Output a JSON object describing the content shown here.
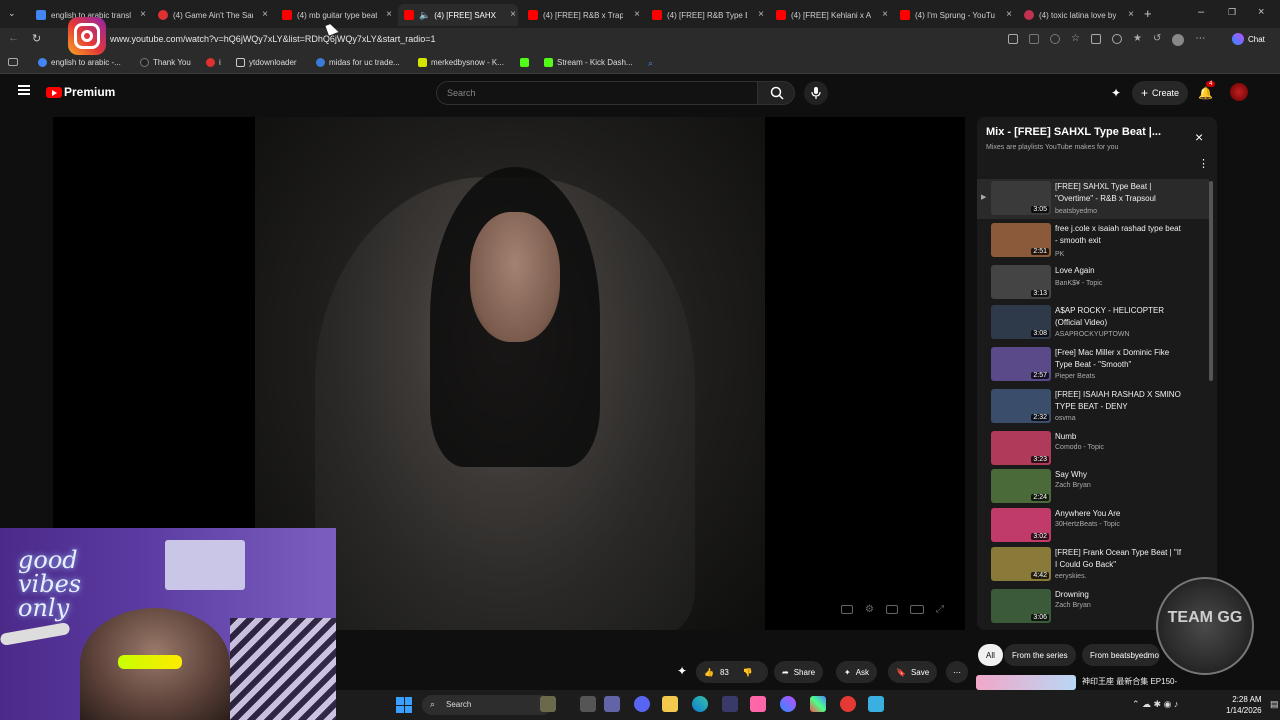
{
  "tabs": [
    {
      "label": "english to arabic translate"
    },
    {
      "label": "(4) Game Ain't The Same"
    },
    {
      "label": "(4) mb guitar type beat"
    },
    {
      "label": "(4) [FREE] SAHXL Type Beat"
    },
    {
      "label": "(4) [FREE] R&B x Trapsoul"
    },
    {
      "label": "(4) [FREE] R&B Type Beat"
    },
    {
      "label": "(4) [FREE] Kehlani x Aaliyah"
    },
    {
      "label": "(4) I'm Sprung - YouTube"
    },
    {
      "label": "(4) toxic latina love by"
    }
  ],
  "address": {
    "url": "www.youtube.com/watch?v=hQ6jWQy7xLY&list=RDhQ6jWQy7xLY&start_radio=1"
  },
  "chat_label": "Chat",
  "bookmarks": [
    {
      "label": "english to arabic -..."
    },
    {
      "label": "Thank You"
    },
    {
      "label": "i"
    },
    {
      "label": "ytdownloader"
    },
    {
      "label": "midas for uc trade..."
    },
    {
      "label": "merkedbysnow - K..."
    },
    {
      "label": "Stream - Kick Dash..."
    }
  ],
  "header": {
    "logo_text": "Premium",
    "search_placeholder": "Search",
    "create_label": "Create",
    "notif_count": "4"
  },
  "playlist": {
    "title": "Mix - [FREE] SAHXL Type Beat |...",
    "subtitle": "Mixes are playlists YouTube makes for you",
    "items": [
      {
        "title": "[FREE] SAHXL Type Beat | \"Overtime\" - R&B x Trapsoul",
        "channel": "beatsbyedmo",
        "duration": "3:05",
        "color": "#3a3a3a"
      },
      {
        "title": "free j.cole x isaiah rashad type beat - smooth exit",
        "channel": "PK",
        "duration": "2:51",
        "color": "#8a5a3a"
      },
      {
        "title": "Love Again",
        "channel": "BanK$¥ - Topic",
        "duration": "3:13",
        "color": "#444"
      },
      {
        "title": "A$AP ROCKY - HELICOPTER (Official Video)",
        "channel": "ASAPROCKYUPTOWN",
        "duration": "3:08",
        "color": "#2e3a4a"
      },
      {
        "title": "[Free] Mac Miller x Dominic Fike Type Beat - \"Smooth\"",
        "channel": "Pieper Beats",
        "duration": "2:57",
        "color": "#5b4a8a"
      },
      {
        "title": "[FREE] ISAIAH RASHAD X SMINO TYPE BEAT - DENY",
        "channel": "osvma",
        "duration": "2:32",
        "color": "#3a4d6a"
      },
      {
        "title": "Numb",
        "channel": "Comodo - Topic",
        "duration": "3:23",
        "color": "#b03a5a"
      },
      {
        "title": "Say Why",
        "channel": "Zach Bryan",
        "duration": "2:24",
        "color": "#4a6a3a"
      },
      {
        "title": "Anywhere You Are",
        "channel": "30HertzBeats - Topic",
        "duration": "3:02",
        "color": "#c03a6a"
      },
      {
        "title": "[FREE] Frank Ocean Type Beat | \"If I Could Go Back\"",
        "channel": "eeryskies.",
        "duration": "4:42",
        "color": "#8a7a3a"
      },
      {
        "title": "Drowning",
        "channel": "Zach Bryan",
        "duration": "3:06",
        "color": "#3a5a3a"
      }
    ]
  },
  "actions": {
    "like_count": "83",
    "share_label": "Share",
    "ask_label": "Ask",
    "save_label": "Save"
  },
  "chips": [
    {
      "label": "All"
    },
    {
      "label": "From the series"
    },
    {
      "label": "From beatsbyedmo"
    }
  ],
  "bottom_video_title": "神印王座 最新合集 EP150-",
  "webcam_text": "good vibes only",
  "team_gg_text": "TEAM GG",
  "taskbar": {
    "search_label": "Search",
    "time": "2:28 AM",
    "date": "1/14/2026"
  },
  "colors": {
    "yt_red": "#ff0000",
    "accent": "#3ea6ff"
  }
}
